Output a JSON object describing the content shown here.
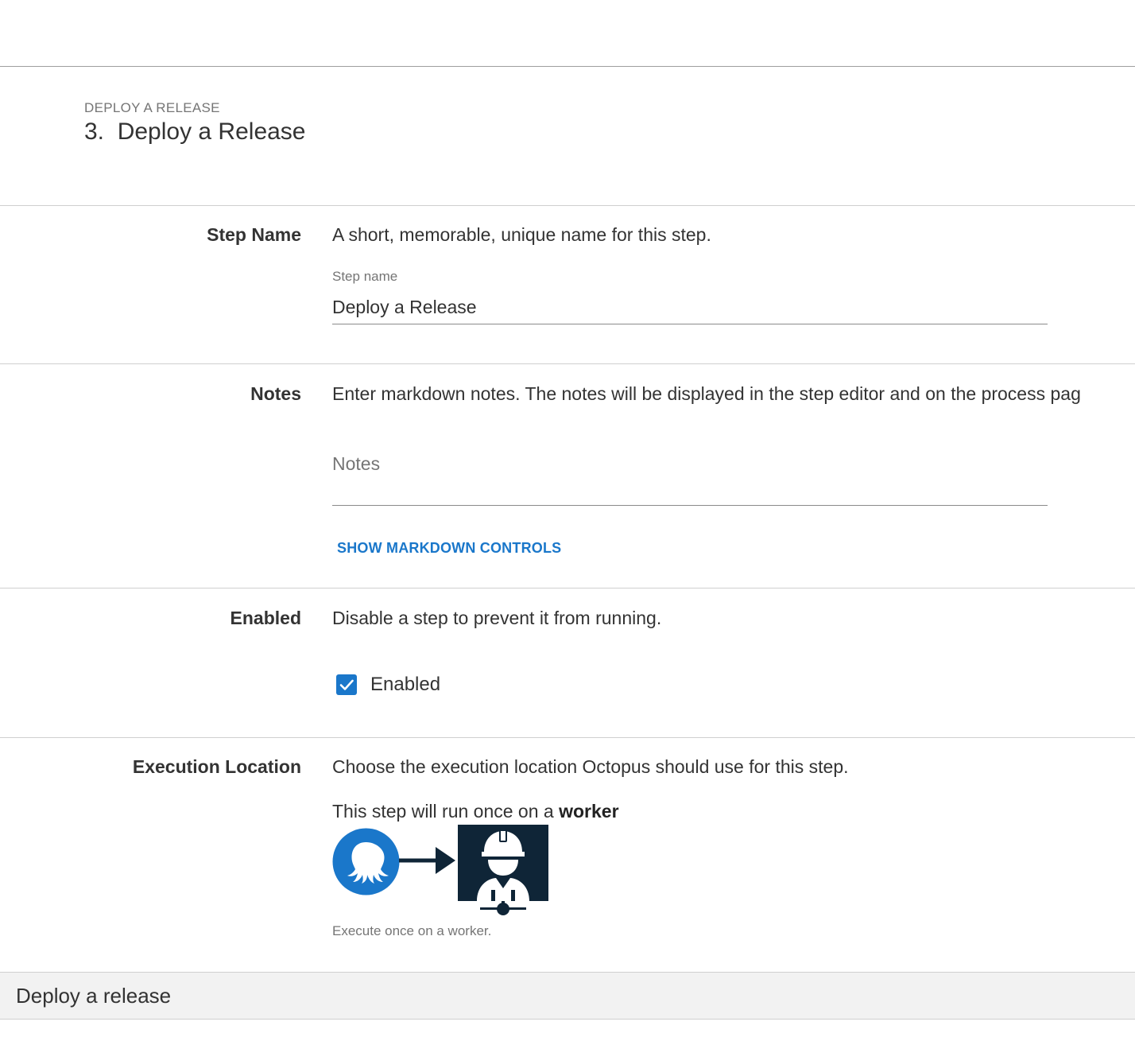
{
  "header": {
    "eyebrow": "DEPLOY A RELEASE",
    "title": "3.  Deploy a Release"
  },
  "sections": {
    "step_name": {
      "label": "Step Name",
      "help": "A short, memorable, unique name for this step.",
      "field_caption": "Step name",
      "field_value": "Deploy a Release"
    },
    "notes": {
      "label": "Notes",
      "help": "Enter markdown notes. The notes will be displayed in the step editor and on the process pag",
      "placeholder": "Notes",
      "markdown_toggle": "SHOW MARKDOWN CONTROLS"
    },
    "enabled": {
      "label": "Enabled",
      "help": "Disable a step to prevent it from running.",
      "checkbox_label": "Enabled",
      "checked": true
    },
    "execution_location": {
      "label": "Execution Location",
      "help": "Choose the execution location Octopus should use for this step.",
      "run_text_prefix": "This step will run once on a",
      "run_text_emphasis": "worker",
      "caption": "Execute once on a worker."
    }
  },
  "subheader": {
    "title": "Deploy a release"
  },
  "icons": {
    "step": "deploy-release-step-icon",
    "octopus": "octopus-server-icon",
    "arrow": "arrow-right-icon",
    "worker": "worker-icon"
  },
  "colors": {
    "accent": "#1a77ca",
    "step_icon": "#2f93e0",
    "worker_bg": "#0f2537"
  }
}
